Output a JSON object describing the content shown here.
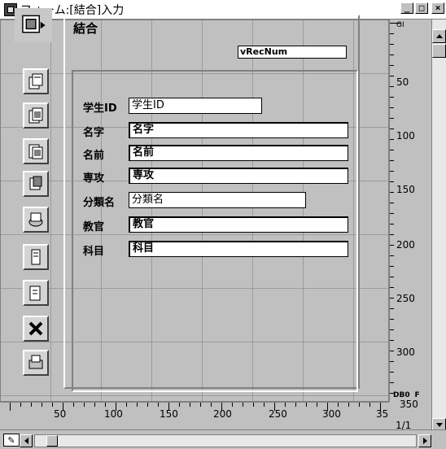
{
  "window": {
    "title": "フォーム:[結合]入力",
    "minimize_label": "_",
    "maximize_label": "□",
    "close_label": "×"
  },
  "form": {
    "title": "結合",
    "record_number_field": "vRecNum"
  },
  "fields": [
    {
      "label": "学生ID",
      "value": "学生ID"
    },
    {
      "label": "名字",
      "value": "名字"
    },
    {
      "label": "名前",
      "value": "名前"
    },
    {
      "label": "専攻",
      "value": "専攻"
    },
    {
      "label": "分類名",
      "value": "分類名"
    },
    {
      "label": "教官",
      "value": "教官"
    },
    {
      "label": "科目",
      "value": "科目"
    }
  ],
  "tools": [
    "layout-icon",
    "first-record-icon",
    "previous-record-icon",
    "next-record-icon",
    "last-record-icon",
    "save-record-icon",
    "add-record-icon",
    "delete-record-icon",
    "cancel-icon",
    "print-icon"
  ],
  "vertical_ruler": {
    "top_label": "GI",
    "labels": [
      "50",
      "100",
      "150",
      "200",
      "250",
      "300"
    ],
    "bottom_label": "350",
    "pointer_label": "DB0",
    "pointer_suffix": "F"
  },
  "horizontal_ruler": {
    "labels": [
      "50",
      "100",
      "150",
      "200",
      "250",
      "300",
      "35"
    ]
  },
  "page_indicator": "1/1",
  "pencil_label": "✎",
  "colors": {
    "window_bg": "#c0c0c0",
    "titlebar_bg": "#ffffff",
    "field_bg": "#ffffff"
  }
}
